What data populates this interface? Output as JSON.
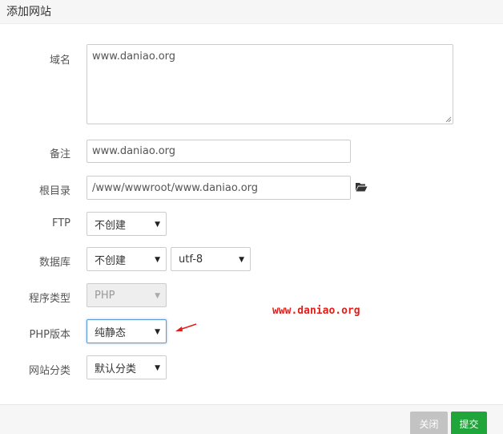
{
  "dialog": {
    "title": "添加网站"
  },
  "form": {
    "domain": {
      "label": "域名",
      "value": "www.daniao.org"
    },
    "remark": {
      "label": "备注",
      "value": "www.daniao.org"
    },
    "root_dir": {
      "label": "根目录",
      "value": "/www/wwwroot/www.daniao.org"
    },
    "ftp": {
      "label": "FTP",
      "selected": "不创建"
    },
    "database": {
      "label": "数据库",
      "selected": "不创建",
      "charset": "utf-8"
    },
    "program_type": {
      "label": "程序类型",
      "selected": "PHP"
    },
    "php_version": {
      "label": "PHP版本",
      "selected": "纯静态"
    },
    "site_category": {
      "label": "网站分类",
      "selected": "默认分类"
    }
  },
  "annotation": {
    "text": "www.daniao.org",
    "color": "#e0201b"
  },
  "footer": {
    "close_label": "关闭",
    "submit_label": "提交"
  },
  "colors": {
    "submit": "#20a53a",
    "close": "#c3c3c3",
    "focus": "#5b9bd5"
  }
}
